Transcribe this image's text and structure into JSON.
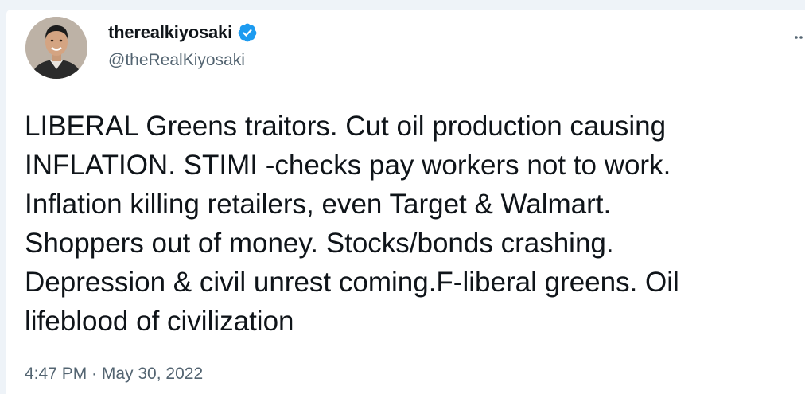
{
  "tweet": {
    "display_name": "therealkiyosaki",
    "handle": "@theRealKiyosaki",
    "verified": true,
    "text": "LIBERAL Greens traitors. Cut oil production causing\nINFLATION. STIMI -checks pay workers not to work.\nInflation killing retailers, even Target & Walmart.\nShoppers out of money. Stocks/bonds crashing.\nDepression & civil unrest coming.F-liberal greens. Oil\nlifeblood of civilization",
    "timestamp": "4:47 PM · May 30, 2022"
  },
  "icons": {
    "verified": "verified-badge-icon",
    "more": "more-options-icon"
  },
  "colors": {
    "verified_blue": "#1d9bf0",
    "secondary_text": "#536471",
    "primary_text": "#0f1419",
    "page_background": "#eef3f8"
  }
}
